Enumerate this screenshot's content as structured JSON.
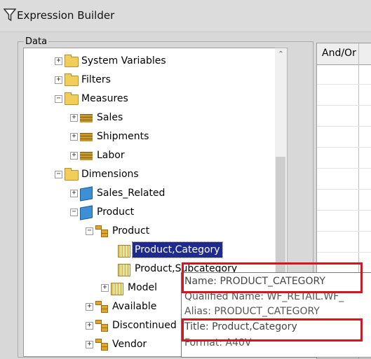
{
  "window": {
    "title": "Expression Builder"
  },
  "data_group": {
    "label": "Data"
  },
  "tree": [
    {
      "label": "System Variables",
      "expander": "+",
      "icon": "folder-icon"
    },
    {
      "label": "Filters",
      "expander": "+",
      "icon": "folder-icon"
    },
    {
      "label": "Measures",
      "expander": "−",
      "icon": "folder-icon"
    },
    {
      "label": "Sales",
      "expander": "+",
      "icon": "measure-group-icon"
    },
    {
      "label": "Shipments",
      "expander": "+",
      "icon": "measure-group-icon"
    },
    {
      "label": "Labor",
      "expander": "+",
      "icon": "measure-group-icon"
    },
    {
      "label": "Dimensions",
      "expander": "−",
      "icon": "folder-icon"
    },
    {
      "label": "Sales_Related",
      "expander": "+",
      "icon": "dimension-cube-icon"
    },
    {
      "label": "Product",
      "expander": "−",
      "icon": "dimension-cube-icon"
    },
    {
      "label": "Product",
      "expander": "−",
      "icon": "hierarchy-icon"
    },
    {
      "label": "Product,Category",
      "expander": "",
      "icon": "field-icon",
      "selected": true
    },
    {
      "label": "Product,Subcategory",
      "expander": "",
      "icon": "field-icon"
    },
    {
      "label": "Model",
      "expander": "+",
      "icon": "field-icon"
    },
    {
      "label": "Available",
      "expander": "+",
      "icon": "hierarchy-icon"
    },
    {
      "label": "Discontinued",
      "expander": "+",
      "icon": "hierarchy-icon"
    },
    {
      "label": "Vendor",
      "expander": "+",
      "icon": "hierarchy-icon"
    }
  ],
  "grid": {
    "header": "And/Or"
  },
  "tooltip": {
    "name": "Name: PRODUCT_CATEGORY",
    "qualified_name": "Qualified Name: WF_RETAIL.WF_",
    "alias": "Alias: PRODUCT_CATEGORY",
    "title": "Title: Product,Category",
    "format": "Format: A40V"
  },
  "colors": {
    "highlight": "#d8141f",
    "selection": "#1e2a8c",
    "folder": "#f1cd5b",
    "dimension": "#3d8fd6"
  }
}
